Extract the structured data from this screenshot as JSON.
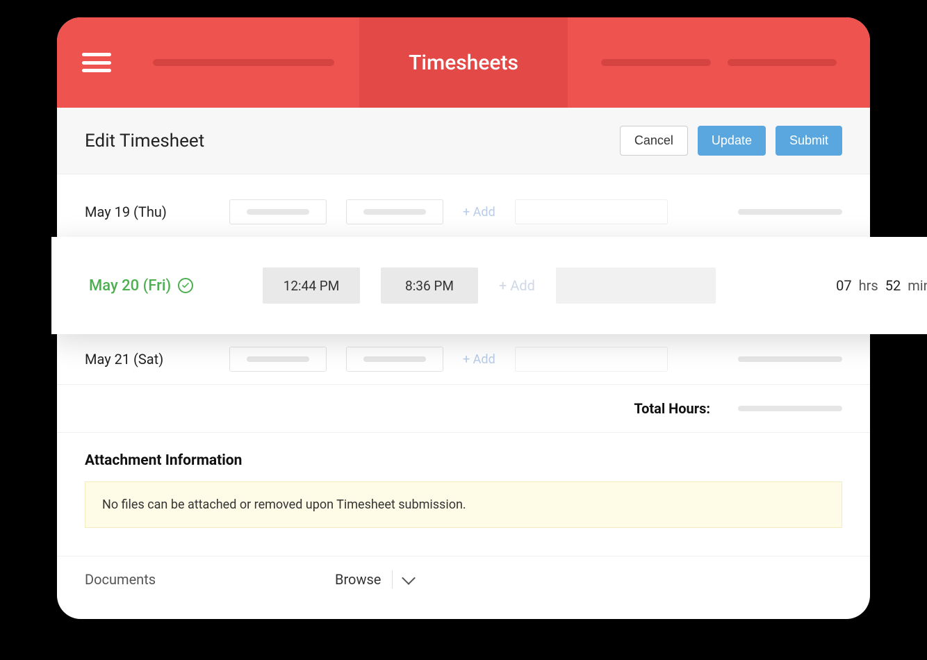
{
  "header": {
    "title": "Timesheets"
  },
  "subheader": {
    "title": "Edit Timesheet",
    "cancel": "Cancel",
    "update": "Update",
    "submit": "Submit"
  },
  "rows": {
    "r0": {
      "date": "May 19 (Thu)",
      "add": "+ Add"
    },
    "r1": {
      "date": "May 20 (Fri)",
      "start": "12:44 PM",
      "end": "8:36 PM",
      "add": "+ Add",
      "dur_hrs_num": "07",
      "dur_hrs_unit": "hrs",
      "dur_min_num": "52",
      "dur_min_unit": "mins"
    },
    "r2": {
      "date": "May 21 (Sat)",
      "add": "+ Add"
    }
  },
  "total": {
    "label": "Total Hours:"
  },
  "attachment": {
    "title": "Attachment Information",
    "warning": "No files can be attached or removed upon Timesheet submission."
  },
  "documents": {
    "label": "Documents",
    "browse": "Browse"
  }
}
